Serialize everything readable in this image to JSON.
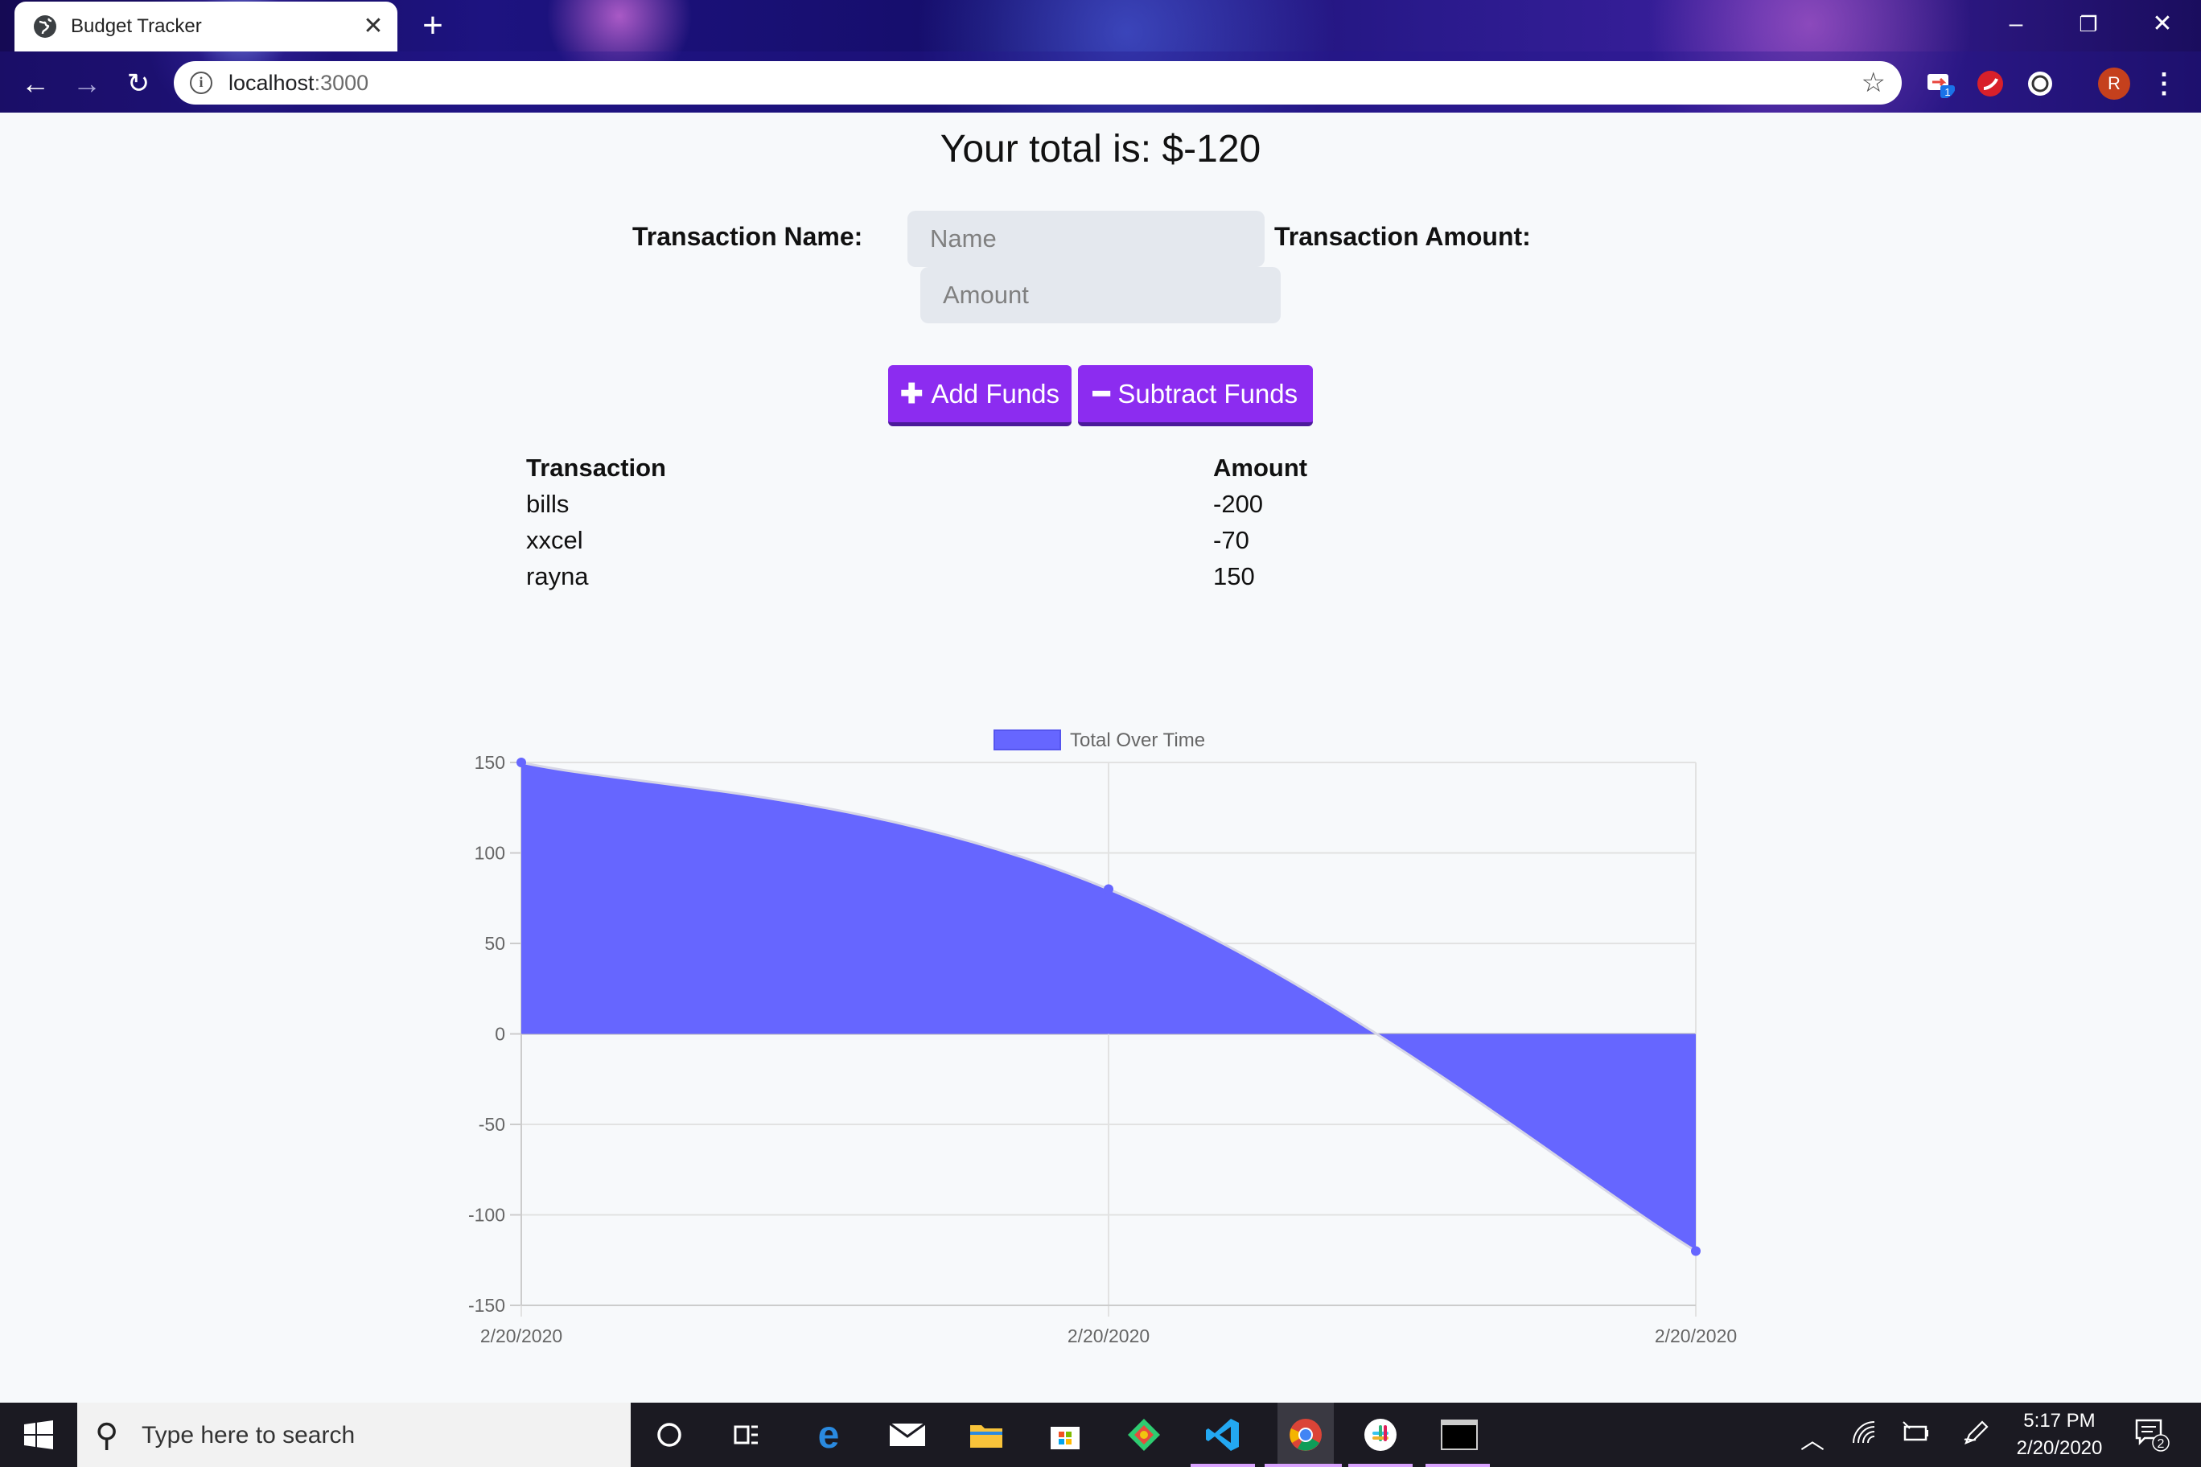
{
  "browser": {
    "tab_title": "Budget Tracker",
    "url_host": "localhost",
    "url_port": ":3000",
    "profile_initial": "R",
    "ext_badge": "1"
  },
  "page": {
    "total_text": "Your total is: $-120",
    "name_label": "Transaction Name:",
    "name_placeholder": "Name",
    "amount_label": "Transaction Amount:",
    "amount_placeholder": "Amount",
    "add_label": "Add Funds",
    "subtract_label": "Subtract Funds"
  },
  "table": {
    "headers": [
      "Transaction",
      "Amount"
    ],
    "rows": [
      {
        "name": "bills",
        "amount": "-200"
      },
      {
        "name": "xxcel",
        "amount": "-70"
      },
      {
        "name": "rayna",
        "amount": "150"
      }
    ]
  },
  "chart_data": {
    "type": "area",
    "legend": "Total Over Time",
    "legend_position": "top",
    "x": [
      "2/20/2020",
      "2/20/2020",
      "2/20/2020"
    ],
    "series": [
      {
        "name": "Total Over Time",
        "values": [
          150,
          80,
          -120
        ]
      }
    ],
    "ylim": [
      -150,
      150
    ],
    "yticks": [
      150,
      100,
      50,
      0,
      -50,
      -100,
      -150
    ],
    "grid": true,
    "fill_color": "#6666ff",
    "line_color": "#d6d6e6"
  },
  "taskbar": {
    "search_placeholder": "Type here to search",
    "time": "5:17 PM",
    "date": "2/20/2020",
    "notification_count": "2"
  },
  "colors": {
    "accent": "#8c2cf0",
    "chart_fill": "#6666ff"
  }
}
